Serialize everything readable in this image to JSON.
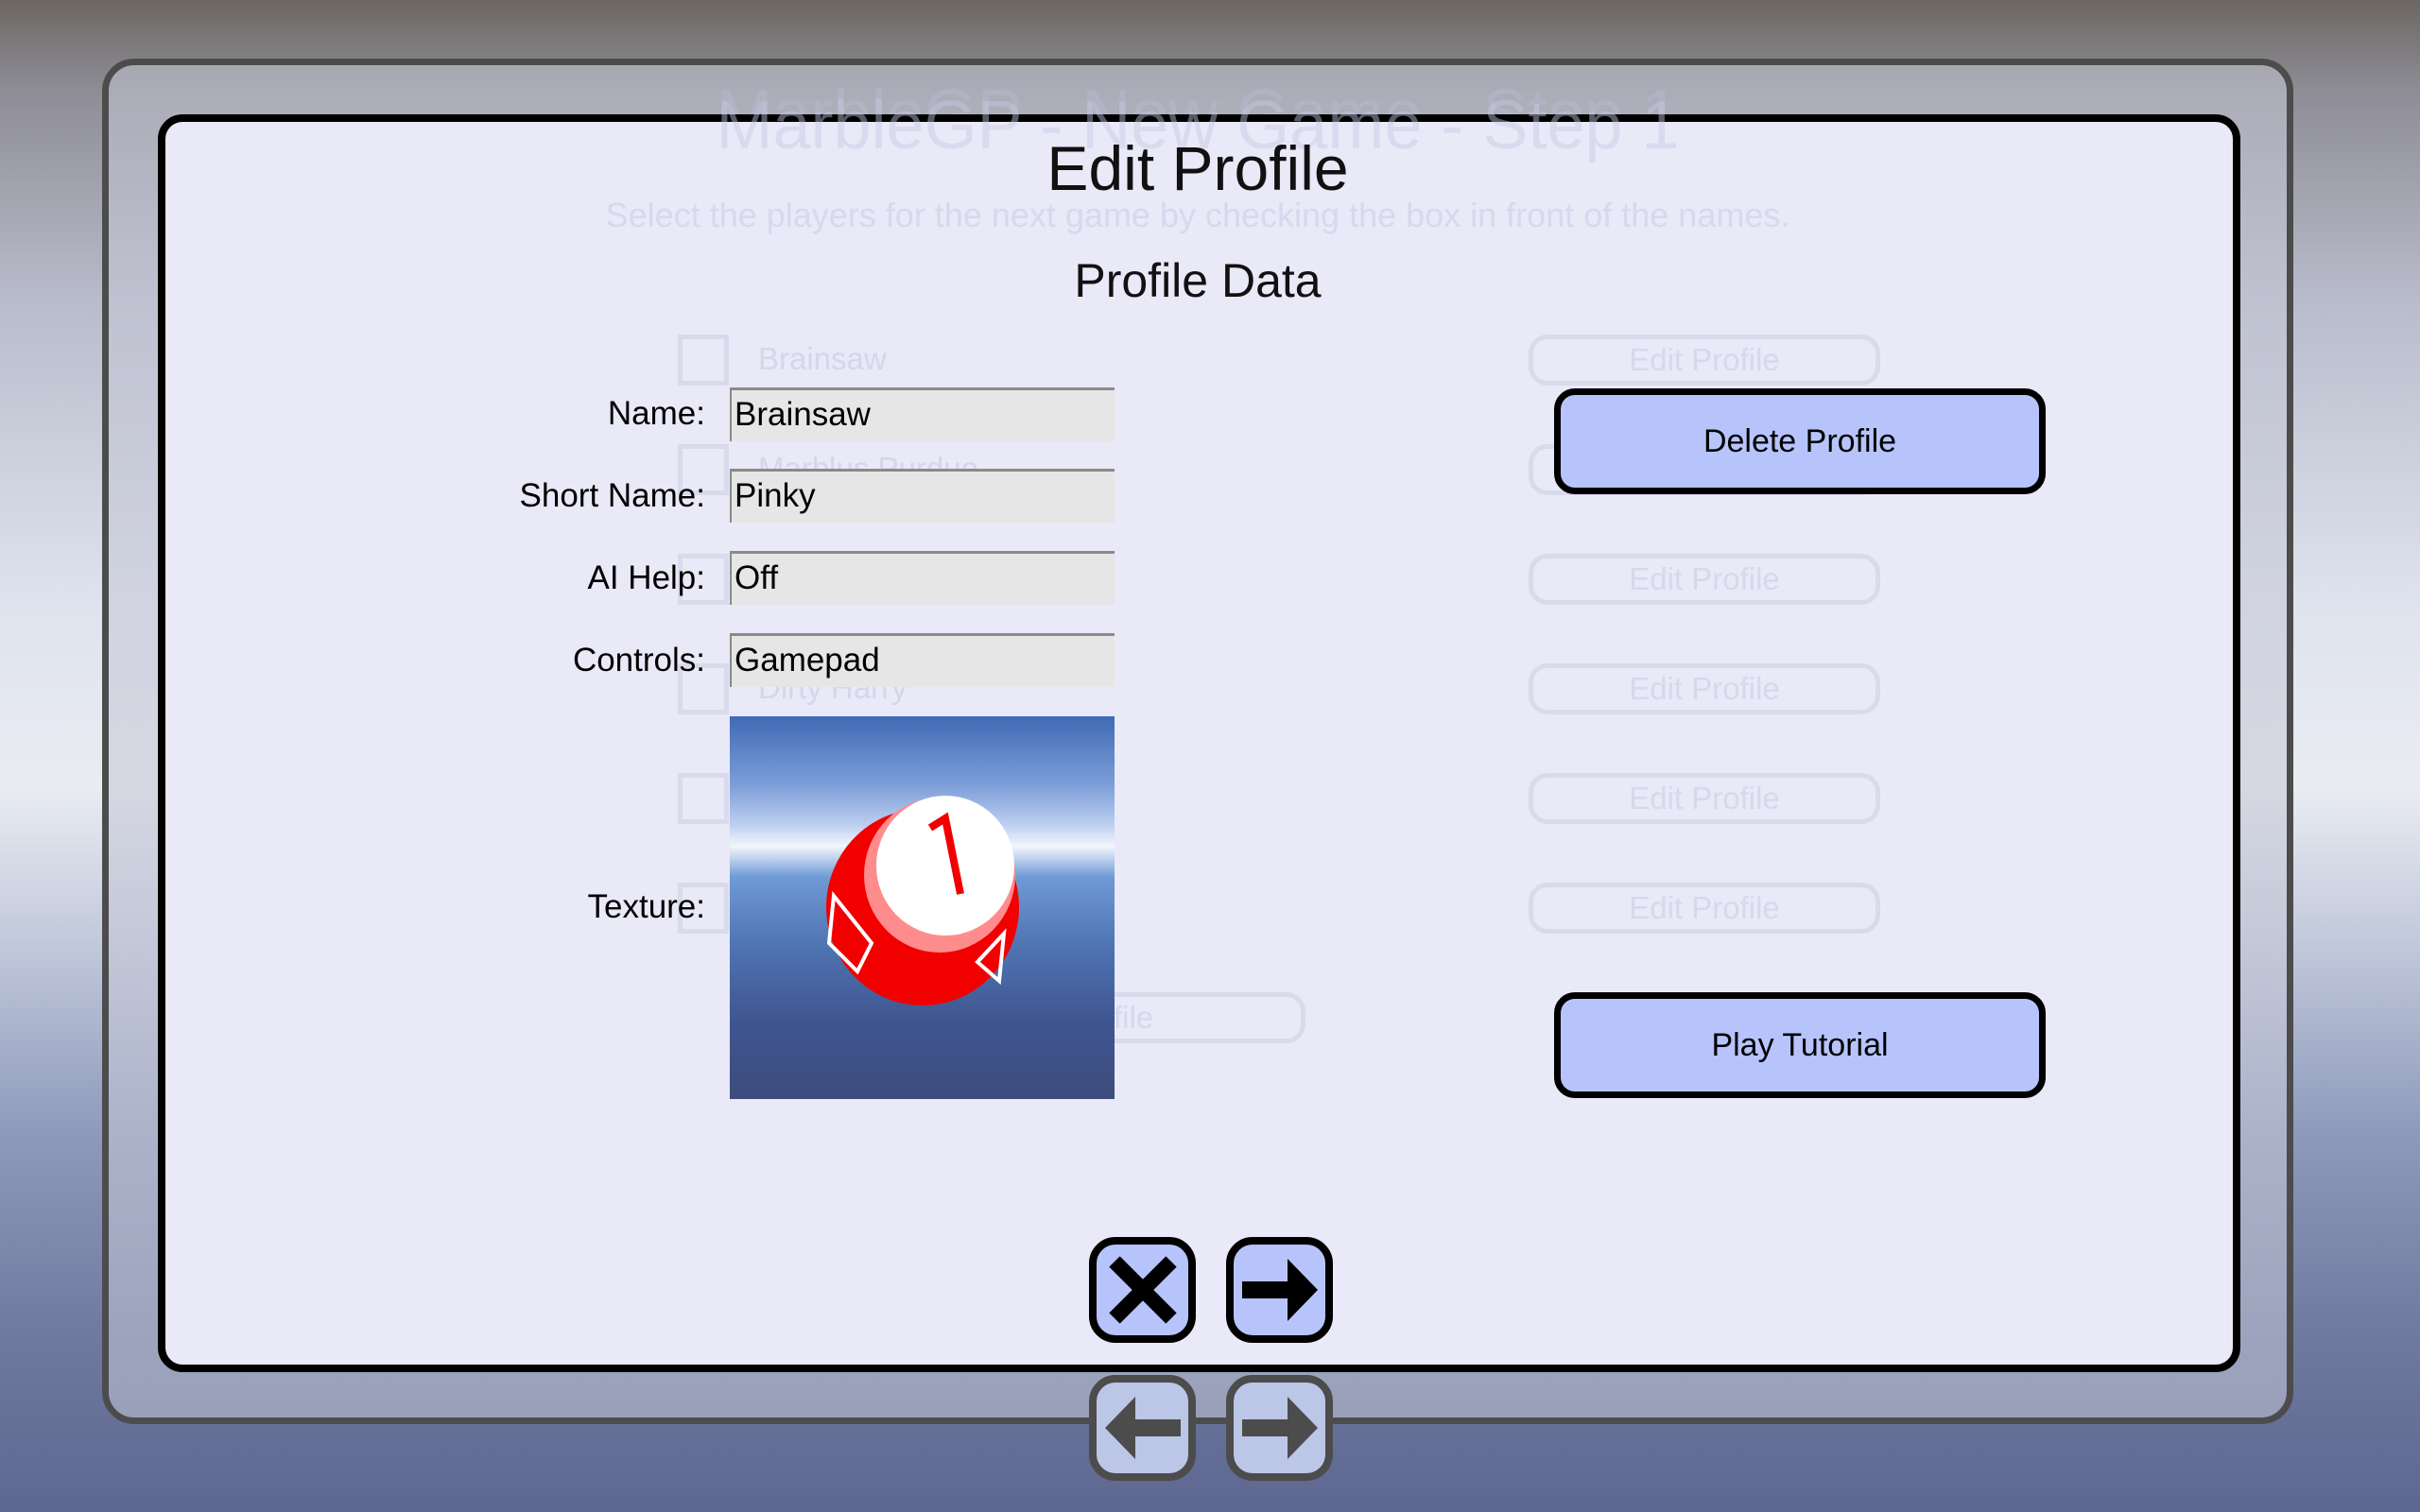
{
  "background_screen": {
    "title": "MarbleGP - New Game - Step 1",
    "subtitle": "Select the players for the next game by checking the box in front of the names.",
    "players": [
      "Brainsaw",
      "Marblus Purdue",
      "",
      "Dirty Harry",
      "",
      ""
    ],
    "edit_button_label": "Edit Profile",
    "partial_button_label": "file"
  },
  "dialog": {
    "title": "Edit Profile",
    "section": "Profile Data",
    "fields": [
      {
        "label": "Name:",
        "value": "Brainsaw"
      },
      {
        "label": "Short Name:",
        "value": "Pinky"
      },
      {
        "label": "AI Help:",
        "value": "Off"
      },
      {
        "label": "Controls:",
        "value": "Gamepad"
      }
    ],
    "texture_label": "Texture:",
    "texture_number": "1",
    "delete_label": "Delete Profile",
    "tutorial_label": "Play Tutorial"
  },
  "icons": {
    "cancel": "close-icon",
    "ok": "arrow-right-icon",
    "back": "arrow-left-icon",
    "next": "arrow-right-icon"
  },
  "colors": {
    "button": "#b7c4fc",
    "dialog": "#e9e9f8",
    "marble": "#ff0000"
  }
}
